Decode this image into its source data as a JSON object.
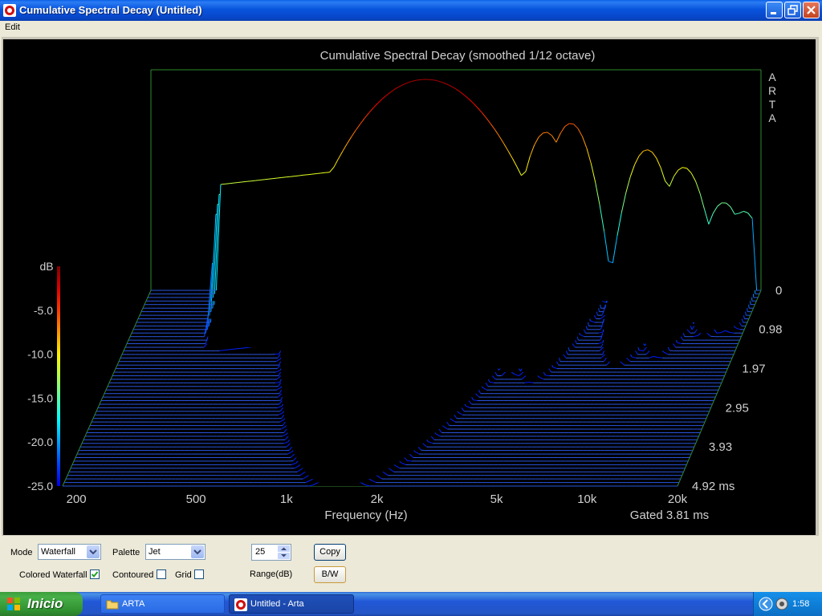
{
  "window": {
    "title": "Cumulative Spectral Decay  (Untitled)"
  },
  "menu": {
    "edit": "Edit"
  },
  "chart_data": {
    "type": "waterfall",
    "title": "Cumulative Spectral Decay (smoothed 1/12 octave)",
    "watermark": "ARTA",
    "xlabel": "Frequency (Hz)",
    "ylabel": "dB",
    "x_scale": "log",
    "xlim": [
      180,
      20000
    ],
    "x_ticks": [
      "200",
      "500",
      "1k",
      "2k",
      "5k",
      "10k",
      "20k"
    ],
    "ylim": [
      -25,
      0
    ],
    "y_ticks": [
      "-5.0",
      "-10.0",
      "-15.0",
      "-20.0",
      "-25.0"
    ],
    "time_ticks": [
      "0",
      "0.98",
      "1.97",
      "2.95",
      "3.93",
      "4.92 ms"
    ],
    "time_range_ms": [
      0,
      4.92
    ],
    "annotation": "Gated 3.81 ms",
    "palette": "Jet",
    "slices": 56,
    "first_slice_peaks": [
      {
        "freq": 1500,
        "db": -1
      },
      {
        "freq": 3800,
        "db": -7
      },
      {
        "freq": 4600,
        "db": -6
      },
      {
        "freq": 8300,
        "db": -9
      },
      {
        "freq": 11000,
        "db": -11
      },
      {
        "freq": 15000,
        "db": -15
      },
      {
        "freq": 17500,
        "db": -16
      }
    ],
    "colors": {
      "background": "#000000",
      "floor": "#2a55e0",
      "axes": "#2e8b2e"
    }
  },
  "controls": {
    "mode_label": "Mode",
    "mode_value": "Waterfall",
    "palette_label": "Palette",
    "palette_value": "Jet",
    "range_value": "25",
    "range_label": "Range(dB)",
    "copy_label": "Copy",
    "bw_label": "B/W",
    "colored_waterfall_label": "Colored Waterfall",
    "colored_waterfall_checked": true,
    "contoured_label": "Contoured",
    "contoured_checked": false,
    "grid_label": "Grid",
    "grid_checked": false
  },
  "taskbar": {
    "start_label": "Inicio",
    "tasks": [
      {
        "label": "ARTA"
      },
      {
        "label": "Untitled - Arta"
      }
    ],
    "clock": "1:58"
  }
}
